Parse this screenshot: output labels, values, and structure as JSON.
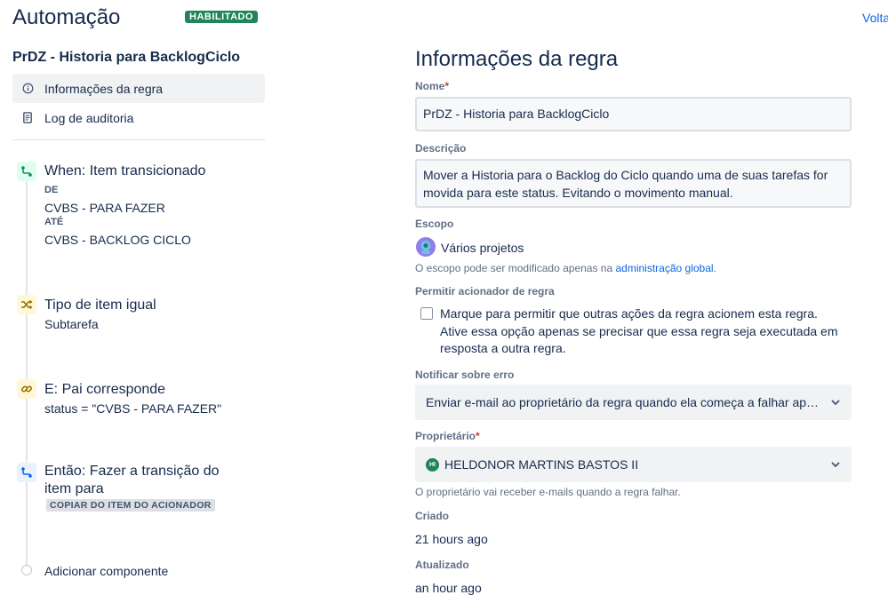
{
  "header": {
    "title": "Automação",
    "status_badge": "HABILITADO",
    "back_link": "Volta"
  },
  "sidebar": {
    "rule_name": "PrDZ - Historia para BacklogCiclo",
    "nav": [
      {
        "label": "Informações da regra",
        "icon": "info-icon",
        "active": true
      },
      {
        "label": "Log de auditoria",
        "icon": "document-icon",
        "active": false
      }
    ]
  },
  "components": {
    "trigger": {
      "title": "When: Item transicionado",
      "from_label": "DE",
      "from_value": "CVBS - PARA FAZER",
      "to_label": "ATÉ",
      "to_value": "CVBS - BACKLOG CICLO"
    },
    "condition_type": {
      "title": "Tipo de item igual",
      "value": "Subtarefa"
    },
    "branch": {
      "title": "E: Pai corresponde",
      "value": "status = \"CVBS - PARA FAZER\""
    },
    "action": {
      "title_line1": "Então: Fazer a transição do",
      "title_line2": "item para",
      "lozenge": "COPIAR DO ITEM DO ACIONADOR"
    },
    "add_component": "Adicionar componente"
  },
  "details": {
    "heading": "Informações da regra",
    "name_label": "Nome",
    "name_value": "PrDZ - Historia para BacklogCiclo",
    "description_label": "Descrição",
    "description_line1": "Mover a Historia para o Backlog do Ciclo quando uma de suas tarefas for",
    "description_line2": "movida para este status. Evitando o movimento manual.",
    "scope_label": "Escopo",
    "scope_value": "Vários projetos",
    "scope_help_prefix": "O escopo pode ser modificado apenas na ",
    "scope_help_link": "administração global",
    "scope_help_suffix": ".",
    "allow_trigger_label": "Permitir acionador de regra",
    "allow_trigger_line1": "Marque para permitir que outras ações da regra acionem esta regra.",
    "allow_trigger_line2": "Ative essa opção apenas se precisar que essa regra seja executada em",
    "allow_trigger_line3": "resposta a outra regra.",
    "allow_trigger_checked": false,
    "notify_label": "Notificar sobre erro",
    "notify_value": "Enviar e-mail ao proprietário da regra quando ela começa a falhar após ter funcionado",
    "owner_label": "Proprietário",
    "owner_initials": "HI",
    "owner_value": "HELDONOR MARTINS BASTOS II",
    "owner_help": "O proprietário vai receber e-mails quando a regra falhar.",
    "created_label": "Criado",
    "created_value": "21 hours ago",
    "updated_label": "Atualizado",
    "updated_value": "an hour ago"
  },
  "colors": {
    "enabled_badge": "#1f845a",
    "link": "#0c66e4",
    "trigger_icon_bg": "#dcfff1",
    "condition_icon_bg": "#fff7d6",
    "action_icon_bg": "#e9f2ff",
    "required": "#c9372c"
  }
}
